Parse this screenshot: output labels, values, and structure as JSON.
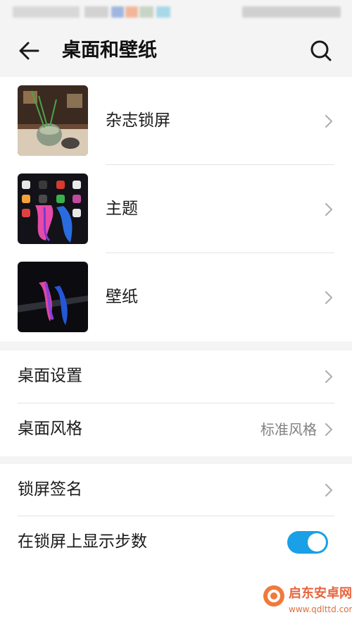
{
  "header": {
    "title": "桌面和壁纸",
    "back_icon": "back-arrow-icon",
    "search_icon": "search-icon"
  },
  "theme_items": [
    {
      "label": "杂志锁屏",
      "thumbnail": "magazine-lockscreen-thumbnail"
    },
    {
      "label": "主题",
      "thumbnail": "theme-thumbnail"
    },
    {
      "label": "壁纸",
      "thumbnail": "wallpaper-thumbnail"
    }
  ],
  "desktop_items": [
    {
      "label": "桌面设置"
    },
    {
      "label": "桌面风格",
      "value": "标准风格"
    }
  ],
  "lockscreen_items": [
    {
      "label": "锁屏签名"
    },
    {
      "label": "在锁屏上显示步数",
      "toggle_on": true
    }
  ],
  "colors": {
    "accent": "#1aa0e6",
    "background": "#f4f4f4",
    "card": "#ffffff"
  }
}
